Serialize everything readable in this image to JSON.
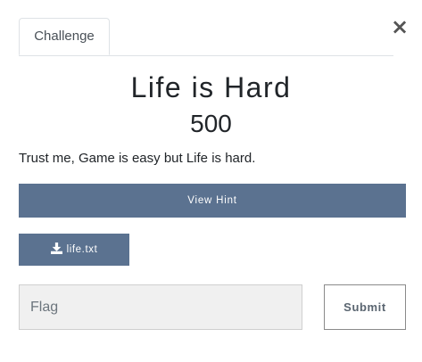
{
  "modal": {
    "close_symbol": "×",
    "tabs": [
      {
        "label": "Challenge"
      }
    ]
  },
  "challenge": {
    "name": "Life is Hard",
    "value": "500",
    "description": "Trust me, Game is easy but Life is hard.",
    "hint_label": "View Hint",
    "files": [
      {
        "name": "life.txt",
        "icon": "download-icon"
      }
    ]
  },
  "submission": {
    "flag_placeholder": "Flag",
    "flag_value": "",
    "submit_label": "Submit"
  },
  "colors": {
    "button_bg": "#5b7290",
    "input_bg": "#f0f0f0"
  }
}
